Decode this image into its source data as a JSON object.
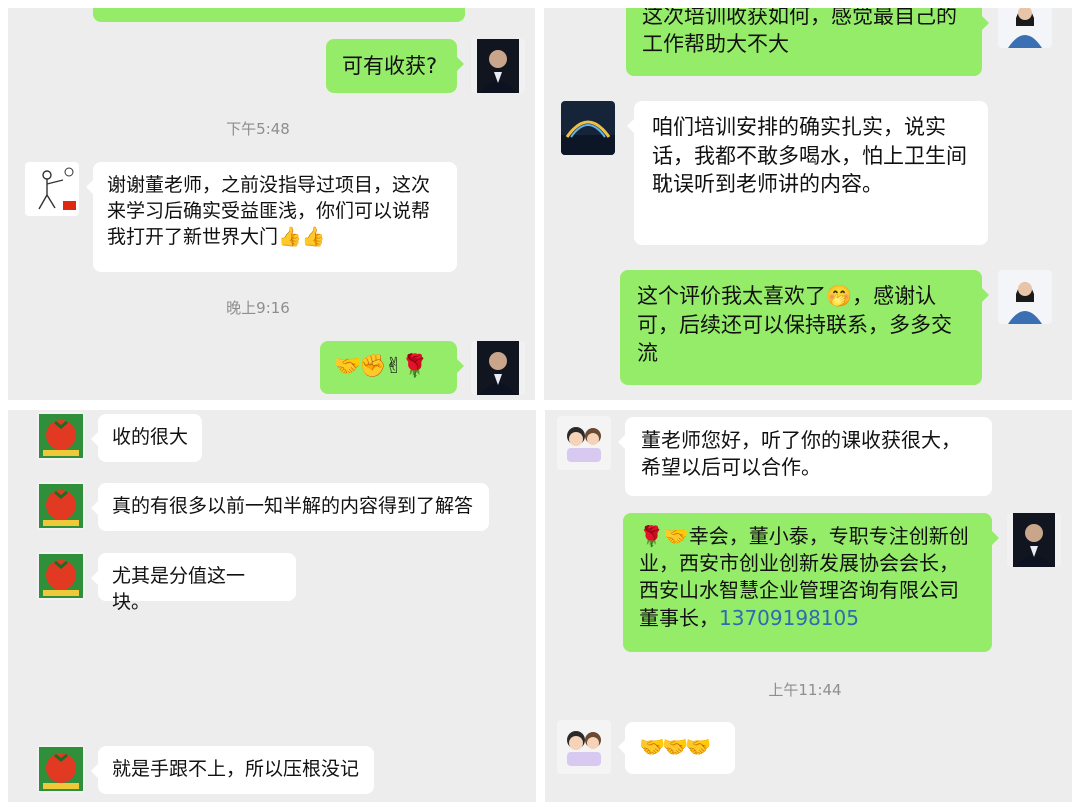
{
  "panel_top_left": {
    "messages": [
      {
        "from": "self",
        "text": "可有收获?"
      },
      {
        "type": "time",
        "text": "下午5:48"
      },
      {
        "from": "other",
        "text": "谢谢董老师，之前没指导过项目，这次来学习后确实受益匪浅，你们可以说帮我打开了新世界大门👍👍"
      },
      {
        "type": "time",
        "text": "晚上9:16"
      },
      {
        "from": "self",
        "text": "🤝✊✌🌹"
      }
    ]
  },
  "panel_top_right": {
    "messages": [
      {
        "from": "self",
        "text": "这次培训收获如何，感觉最自己的工作帮助大不大"
      },
      {
        "from": "other",
        "text": "咱们培训安排的确实扎实，说实话，我都不敢多喝水，怕上卫生间耽误听到老师讲的内容。"
      },
      {
        "from": "self",
        "text": "这个评价我太喜欢了🤭，感谢认可，后续还可以保持联系，多多交流"
      }
    ]
  },
  "panel_bottom_left": {
    "messages": [
      {
        "from": "other",
        "text": "收的很大"
      },
      {
        "from": "other",
        "text": "真的有很多以前一知半解的内容得到了解答"
      },
      {
        "from": "other",
        "text": "尤其是分值这一块。"
      },
      {
        "from": "other",
        "text": "就是手跟不上，所以压根没记"
      }
    ]
  },
  "panel_bottom_right": {
    "messages": [
      {
        "from": "other",
        "text": "董老师您好，听了你的课收获很大，希望以后可以合作。"
      },
      {
        "from": "self",
        "text": "🌹🤝幸会，董小泰，专职专注创新创业，西安市创业创新发展协会会长，西安山水智慧企业管理咨询有限公司董事长，",
        "phone": "13709198105"
      },
      {
        "type": "time",
        "text": "上午11:44"
      },
      {
        "from": "other",
        "text": "🤝🤝🤝"
      }
    ]
  },
  "colors": {
    "panel_bg": "#ededed",
    "green_bubble": "#95ec69",
    "white_bubble": "#ffffff",
    "time_text": "#8e8e8e",
    "phone_link": "#2d6bb3"
  }
}
